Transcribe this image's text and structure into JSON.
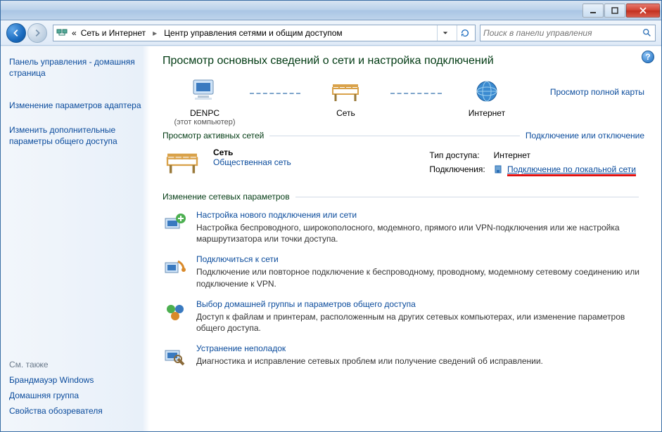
{
  "titlebar": {
    "min_label": "Minimize",
    "max_label": "Maximize",
    "close_label": "Close"
  },
  "breadcrumb": {
    "prefix": "«",
    "items": [
      "Сеть и Интернет",
      "Центр управления сетями и общим доступом"
    ]
  },
  "search": {
    "placeholder": "Поиск в панели управления"
  },
  "sidebar": {
    "home": "Панель управления - домашняя страница",
    "links": [
      "Изменение параметров адаптера",
      "Изменить дополнительные параметры общего доступа"
    ],
    "seealso_title": "См. также",
    "seealso": [
      "Брандмауэр Windows",
      "Домашняя группа",
      "Свойства обозревателя"
    ]
  },
  "main": {
    "heading": "Просмотр основных сведений о сети и настройка подключений",
    "map": {
      "node1_label": "DENPC",
      "node1_sub": "(этот компьютер)",
      "node2_label": "Сеть",
      "node3_label": "Интернет",
      "full_map_link": "Просмотр полной карты"
    },
    "active_hdr": "Просмотр активных сетей",
    "active_link": "Подключение или отключение",
    "active_net": {
      "name": "Сеть",
      "type_link": "Общественная сеть",
      "access_label": "Тип доступа:",
      "access_value": "Интернет",
      "conn_label": "Подключения:",
      "conn_link": "Подключение по локальной сети"
    },
    "settings_hdr": "Изменение сетевых параметров",
    "tasks": [
      {
        "title": "Настройка нового подключения или сети",
        "desc": "Настройка беспроводного, широкополосного, модемного, прямого или VPN-подключения или же настройка маршрутизатора или точки доступа."
      },
      {
        "title": "Подключиться к сети",
        "desc": "Подключение или повторное подключение к беспроводному, проводному, модемному сетевому соединению или подключение к VPN."
      },
      {
        "title": "Выбор домашней группы и параметров общего доступа",
        "desc": "Доступ к файлам и принтерам, расположенным на других сетевых компьютерах, или изменение параметров общего доступа."
      },
      {
        "title": "Устранение неполадок",
        "desc": "Диагностика и исправление сетевых проблем или получение сведений об исправлении."
      }
    ]
  }
}
